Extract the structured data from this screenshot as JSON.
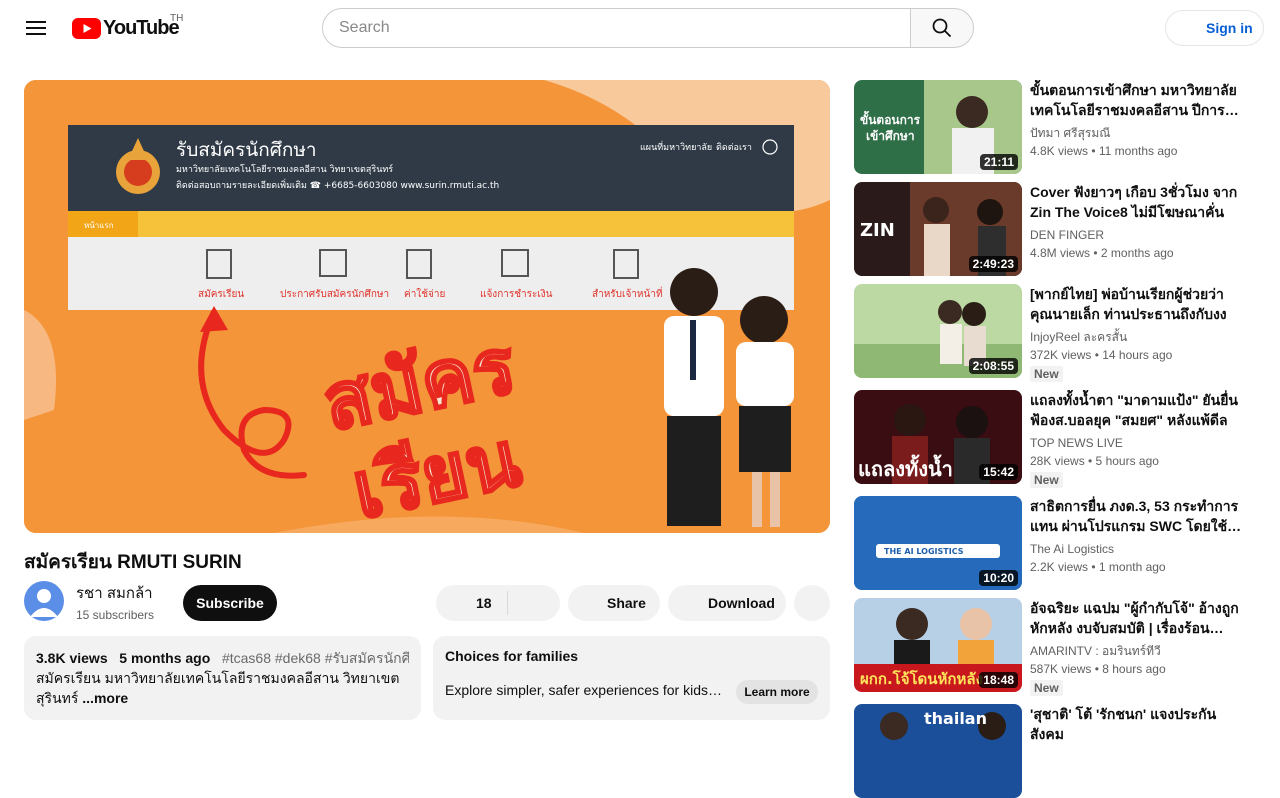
{
  "header": {
    "logo_text": "YouTube",
    "country_code": "TH",
    "search_placeholder": "Search",
    "sign_in_label": "Sign in"
  },
  "thumbnail": {
    "site_title": "รับสมัครนักศึกษา",
    "site_subtitle": "มหาวิทยาลัยเทคโนโลยีราชมงคลอีสาน วิทยาเขตสุรินทร์",
    "site_contact": "ติดต่อสอบถามรายละเอียดเพิ่มเติม ☎ +6685-6603080 www.surin.rmuti.ac.th",
    "site_nav_links": [
      "แผนที่มหาวิทยาลัย",
      "ติดต่อเรา"
    ],
    "home_tab": "หน้าแรก",
    "menu_items": [
      "สมัครเรียน",
      "ประกาศรับสมัครนักศึกษา",
      "ค่าใช้จ่าย",
      "แจ้งการชำระเงิน",
      "สำหรับเจ้าหน้าที่"
    ],
    "big_text_line1": "สมัคร",
    "big_text_line2": "เรียน"
  },
  "video": {
    "title": "สมัครเรียน RMUTI SURIN",
    "channel_name": "รชา สมกล้า",
    "subscribers": "15 subscribers",
    "subscribe_label": "Subscribe",
    "like_count": "18",
    "share_label": "Share",
    "download_label": "Download"
  },
  "description": {
    "views": "3.8K views",
    "age": "5 months ago",
    "tags": "#tcas68 #dek68 #รับสมัครนักศึกษ",
    "line1": "สมัครเรียน มหาวิทยาลัยเทคโนโลยีราชมงคลอีสาน วิทยาเขต",
    "line2": "สุรินทร์",
    "more_label": "...more"
  },
  "families": {
    "title": "Choices for families",
    "text": "Explore simpler, safer experiences for kids and families",
    "button": "Learn more"
  },
  "recommendations": [
    {
      "title": "ขั้นตอนการเข้าศึกษา มหาวิทยาลัยเทคโนโลยีราชมงคลอีสาน ปีการศึกษา",
      "channel": "ปัทมา ศรีสุรมณี",
      "stats": "4.8K views • 11 months ago",
      "duration": "21:11",
      "badge": "",
      "thumb_text": "ขั้นตอนการ\nเข้าศึกษา"
    },
    {
      "title": "Cover ฟังยาวๆ เกือบ 3ชั่วโมง จาก Zin The Voice8 ไม่มีโฆษณาคั่น",
      "channel": "DEN FINGER",
      "stats": "4.8M views • 2 months ago",
      "duration": "2:49:23",
      "badge": "",
      "thumb_text": "ZIN"
    },
    {
      "title": "[พากย์ไทย] พ่อบ้านเรียกผู้ช่วยว่าคุณนายเล็ก ท่านประธานถึงกับงง",
      "channel": "InjoyReel ละครสั้น",
      "stats": "372K views • 14 hours ago",
      "duration": "2:08:55",
      "badge": "New",
      "thumb_text": ""
    },
    {
      "title": "แถลงทั้งน้ำตา \"มาดามแป้ง\" ยันยื่นฟ้องส.บอลยุค \"สมยศ\" หลังแพ้ดีล",
      "channel": "TOP NEWS LIVE",
      "stats": "28K views • 5 hours ago",
      "duration": "15:42",
      "badge": "New",
      "thumb_text": "แถลงทั้งน้ำ"
    },
    {
      "title": "สาธิตการยื่น ภงด.3, 53 กระทำการแทน ผ่านโปรแกรม SWC โดยใช้โปรแกรม",
      "channel": "The Ai Logistics",
      "stats": "2.2K views • 1 month ago",
      "duration": "10:20",
      "badge": "",
      "thumb_text": "THE AI LOGISTICS"
    },
    {
      "title": "อัจฉริยะ แฉปม \"ผู้กำกับโจ้\" อ้างถูกหักหลัง งบจับสมบัติ | เรื่องร้อนอมรินทร์",
      "channel": "AMARINTV : อมรินทร์ทีวี",
      "stats": "587K views • 8 hours ago",
      "duration": "18:48",
      "badge": "New",
      "thumb_text": "ผกก.โจ้โดนหักหลัง"
    },
    {
      "title": "'สุชาติ' โต้ 'รักชนก' แจงประกันสังคม",
      "channel": "",
      "stats": "",
      "duration": "",
      "badge": "",
      "thumb_text": "thailan"
    }
  ]
}
